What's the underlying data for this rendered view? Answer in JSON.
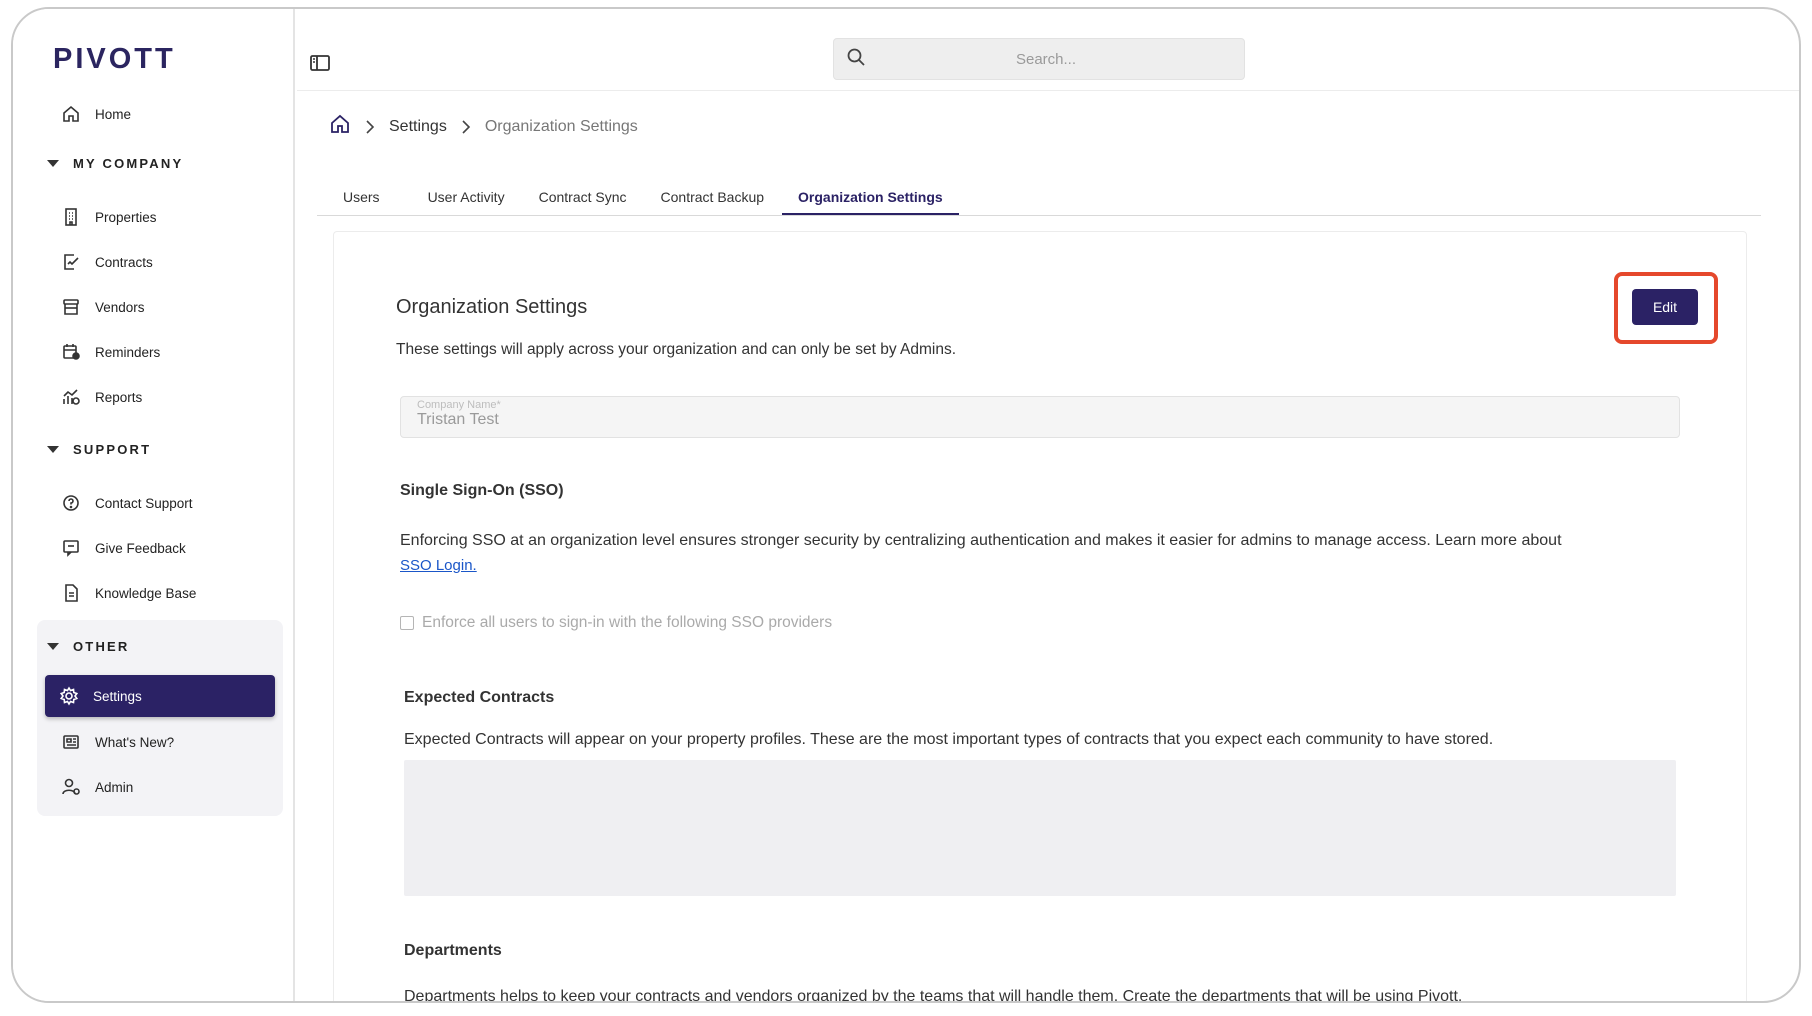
{
  "brand": {
    "logo": "PIVOTT"
  },
  "sidebar": {
    "home": "Home",
    "sections": [
      {
        "title": "MY COMPANY",
        "items": [
          "Properties",
          "Contracts",
          "Vendors",
          "Reminders",
          "Reports"
        ]
      },
      {
        "title": "SUPPORT",
        "items": [
          "Contact Support",
          "Give Feedback",
          "Knowledge Base"
        ]
      },
      {
        "title": "OTHER",
        "items": [
          "Settings",
          "What's New?",
          "Admin"
        ]
      }
    ],
    "active_item": "Settings"
  },
  "search": {
    "placeholder": "Search..."
  },
  "breadcrumb": {
    "settings": "Settings",
    "current": "Organization Settings"
  },
  "tabs": [
    "Users",
    "User Activity",
    "Contract Sync",
    "Contract Backup",
    "Organization Settings"
  ],
  "active_tab": "Organization Settings",
  "card": {
    "title": "Organization Settings",
    "description": "These settings will apply across your organization and can only be set by Admins.",
    "edit_label": "Edit",
    "company_field": {
      "label": "Company Name*",
      "value": "Tristan Test"
    },
    "sso": {
      "title": "Single Sign-On (SSO)",
      "text": "Enforcing SSO at an organization level ensures stronger security by centralizing authentication and makes it easier for admins to manage access. Learn more about",
      "link": "SSO Login.",
      "checkbox_label": "Enforce all users to sign-in with the following SSO providers"
    },
    "expected_contracts": {
      "title": "Expected Contracts",
      "text": "Expected Contracts will appear on your property profiles. These are the most important types of contracts that you expect each community to have stored."
    },
    "departments": {
      "title": "Departments",
      "text": "Departments helps to keep your contracts and vendors organized by the teams that will handle them. Create the departments that will be using Pivott."
    }
  },
  "colors": {
    "brand": "#2b2265",
    "highlight": "#e5482c",
    "link": "#1a56c8"
  }
}
